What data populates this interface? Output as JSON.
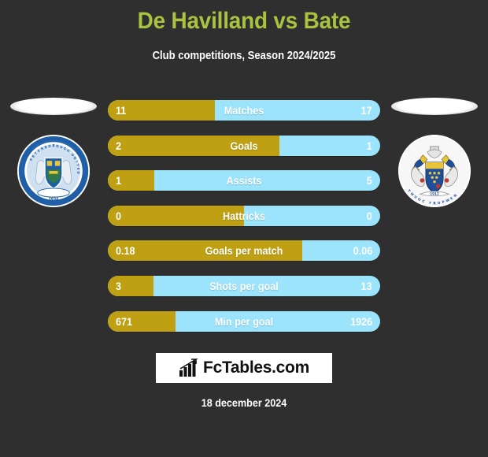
{
  "header": {
    "title": "De Havilland vs Bate",
    "subtitle": "Club competitions, Season 2024/2025",
    "title_color": "#a9c23f"
  },
  "teams": {
    "home": {
      "crest_name": "peterborough-united-crest",
      "crest_text": "PETERBOROUGH UNITED FOOTBALL CLUB",
      "crest_year": "1934"
    },
    "away": {
      "crest_name": "newport-county-crest",
      "crest_text": "NEWPORT COUNTY"
    }
  },
  "colors": {
    "background": "#2f2f2f",
    "home_bar": "#bfa013",
    "away_bar": "#9be4fc",
    "text": "#ffffff"
  },
  "chart_data": {
    "type": "bar",
    "title": "De Havilland vs Bate",
    "subtitle": "Club competitions, Season 2024/2025",
    "orientation": "horizontal-diverging",
    "series": [
      {
        "name": "De Havilland",
        "color": "#bfa013",
        "values": [
          11,
          2,
          1,
          0,
          0.18,
          3,
          671
        ]
      },
      {
        "name": "Bate",
        "color": "#9be4fc",
        "values": [
          17,
          1,
          5,
          0,
          0.06,
          13,
          1926
        ]
      }
    ],
    "categories": [
      "Matches",
      "Goals",
      "Assists",
      "Hattricks",
      "Goals per match",
      "Shots per goal",
      "Min per goal"
    ],
    "rows": [
      {
        "label": "Matches",
        "home": "11",
        "away": "17",
        "home_pct": 39.3
      },
      {
        "label": "Goals",
        "home": "2",
        "away": "1",
        "home_pct": 63.0
      },
      {
        "label": "Assists",
        "home": "1",
        "away": "5",
        "home_pct": 17.0
      },
      {
        "label": "Hattricks",
        "home": "0",
        "away": "0",
        "home_pct": 50.0
      },
      {
        "label": "Goals per match",
        "home": "0.18",
        "away": "0.06",
        "home_pct": 71.5
      },
      {
        "label": "Shots per goal",
        "home": "3",
        "away": "13",
        "home_pct": 16.8
      },
      {
        "label": "Min per goal",
        "home": "671",
        "away": "1926",
        "home_pct": 24.9
      }
    ]
  },
  "branding": {
    "logo_text": "FcTables.com",
    "logo_icon": "bar-chart-arrow-icon"
  },
  "footer": {
    "date": "18 december 2024"
  }
}
